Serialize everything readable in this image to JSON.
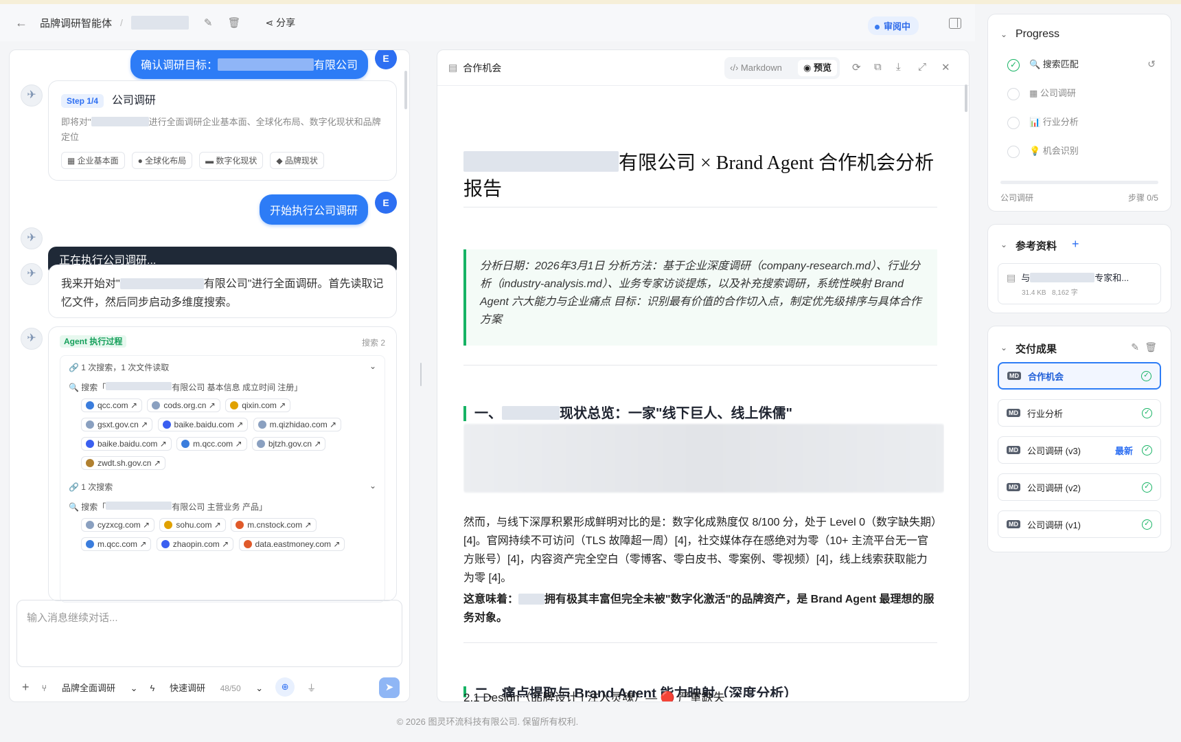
{
  "header": {
    "title": "品牌调研智能体",
    "separator": "/",
    "share": "分享",
    "status": "审阅中"
  },
  "chat": {
    "user_msg1_prefix": "确认调研目标：",
    "user_msg1_suffix": "有限公司",
    "avatar_letter": "E",
    "step_tag": "Step 1/4",
    "step_title": "公司调研",
    "step_desc_a": "即将对\"",
    "step_desc_b": "进行全面调研企业基本面、全球化布局、数字化现状和品牌定位",
    "chips": [
      "企业基本面",
      "全球化布局",
      "数字化现状",
      "品牌现状"
    ],
    "user_msg2": "开始执行公司调研",
    "running": "正在执行公司调研...",
    "reply_a": "我来开始对\"",
    "reply_b": "有限公司\"进行全面调研。首先读取记忆文件，然后同步启动多维度搜索。",
    "agent_tag": "Agent 执行过程",
    "agent_search_count": "搜索 2",
    "group1": "1 次搜索，1 次文件读取",
    "search1_prefix": "搜索「",
    "search1_suffix": "有限公司 基本信息 成立时间 注册」",
    "domains1": [
      "qcc.com",
      "cods.org.cn",
      "qixin.com",
      "gsxt.gov.cn",
      "baike.baidu.com",
      "m.qizhidao.com",
      "baike.baidu.com",
      "m.qcc.com",
      "bjtzh.gov.cn",
      "zwdt.sh.gov.cn"
    ],
    "group2": "1 次搜索",
    "search2_prefix": "搜索「",
    "search2_suffix": "有限公司 主营业务 产品」",
    "domains2": [
      "cyzxcg.com",
      "sohu.com",
      "m.cnstock.com",
      "m.qcc.com",
      "zhaopin.com",
      "data.eastmoney.com"
    ],
    "input_placeholder": "输入消息继续对话...",
    "mode1": "品牌全面调研",
    "mode2": "快速调研",
    "quota": "48/50"
  },
  "doc": {
    "tab_title": "合作机会",
    "markdown": "Markdown",
    "preview": "预览",
    "title_suffix": "有限公司 × Brand Agent 合作机会分析报告",
    "quote": "分析日期：2026年3月1日 分析方法：基于企业深度调研（company-research.md）、行业分析（industry-analysis.md）、业务专家访谈提炼，以及补充搜索调研，系统性映射 Brand Agent 六大能力与企业痛点 目标：识别最有价值的合作切入点，制定优先级排序与具体合作方案",
    "h2_1_prefix": "一、",
    "h2_1_suffix": "现状总览：一家\"线下巨人、线上侏儒\"",
    "para1": "然而，与线下深厚积累形成鲜明对比的是：数字化成熟度仅 8/100 分，处于 Level 0（数字缺失期）[4]。官网持续不可访问（TLS 故障超一周）[4]，社交媒体存在感绝对为零（10+ 主流平台无一官方账号）[4]，内容资产完全空白（零博客、零白皮书、零案例、零视频）[4]，线上线索获取能力为零 [4]。",
    "para2_prefix": "这意味着：",
    "para2_suffix": "拥有极其丰富但完全未被\"数字化激活\"的品牌资产，是 Brand Agent 最理想的服务对象。",
    "h2_2": "二、痛点提取与 Brand Agent 能力映射（深度分析）",
    "h3": "2.1 Design（品牌设计 | 注入灵魂）— 🔴 严重缺失"
  },
  "progress": {
    "title": "Progress",
    "steps": [
      "🔍 搜索匹配",
      "▦ 公司调研",
      "📊 行业分析",
      "💡 机会识别"
    ],
    "current": "公司调研",
    "step_count": "步骤 0/5",
    "completed_steps": 0,
    "total_steps": 5
  },
  "refs": {
    "title": "参考资料",
    "file_prefix": "与",
    "file_suffix": "专家和...",
    "size": "31.4 KB",
    "chars": "8,162 字"
  },
  "deliverables": {
    "title": "交付成果",
    "items": [
      "合作机会",
      "行业分析",
      "公司调研 (v3)",
      "公司调研 (v2)",
      "公司调研 (v1)"
    ],
    "latest": "最新"
  },
  "footer": "© 2026 图灵环流科技有限公司. 保留所有权利."
}
